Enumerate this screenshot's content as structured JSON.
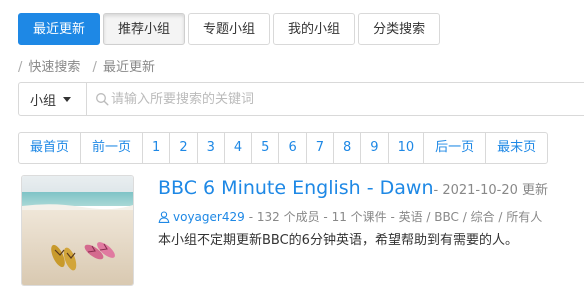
{
  "tabs": [
    "最近更新",
    "推荐小组",
    "专题小组",
    "我的小组",
    "分类搜索"
  ],
  "breadcrumb": [
    "快速搜索",
    "最近更新"
  ],
  "search": {
    "scope": "小组",
    "placeholder": "请输入所要搜索的关键词"
  },
  "pagination": [
    "最首页",
    "前一页",
    "1",
    "2",
    "3",
    "4",
    "5",
    "6",
    "7",
    "8",
    "9",
    "10",
    "后一页",
    "最末页"
  ],
  "group": {
    "title": "BBC 6 Minute English - Dawn",
    "updated": "- 2021-10-20 更新",
    "owner": "voyager429",
    "meta_rest": "- 132 个成员 - 11 个课件 - 英语 / BBC / 综合 / 所有人",
    "description": "本小组不定期更新BBC的6分钟英语，希望帮助到有需要的人。",
    "thumbnail_icon": "beach-sandals-image"
  },
  "colors": {
    "accent": "#1e88e5",
    "muted": "#888888"
  }
}
